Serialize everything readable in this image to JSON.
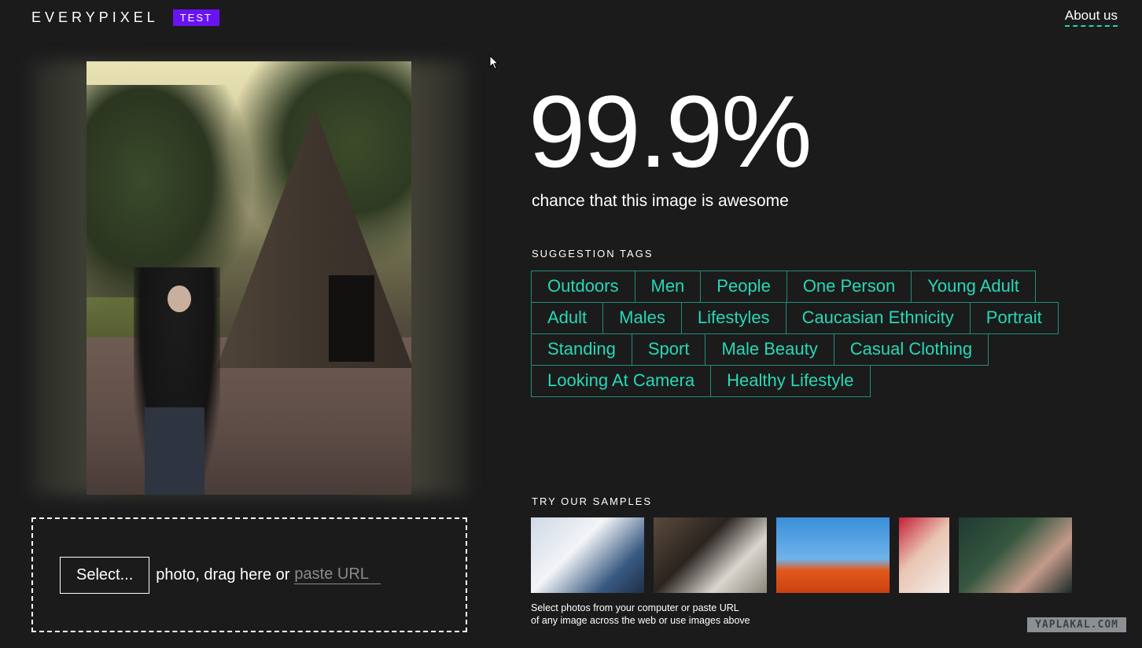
{
  "header": {
    "logo": "EVERYPIXEL",
    "badge": "TEST",
    "about_link": "About us"
  },
  "result": {
    "score": "99.9%",
    "caption": "chance that this image is awesome"
  },
  "tags_section": {
    "label": "SUGGESTION TAGS",
    "rows": [
      [
        "Outdoors",
        "Men",
        "People",
        "One Person",
        "Young Adult"
      ],
      [
        "Adult",
        "Males",
        "Lifestyles",
        "Caucasian Ethnicity",
        "Portrait"
      ],
      [
        "Standing",
        "Sport",
        "Male Beauty",
        "Casual Clothing"
      ],
      [
        "Looking At Camera",
        "Healthy Lifestyle"
      ]
    ]
  },
  "upload": {
    "select_label": "Select...",
    "drop_text": "photo, drag here or",
    "url_placeholder": "paste URL"
  },
  "samples_section": {
    "label": "TRY OUR SAMPLES",
    "hint_line1": "Select photos from your computer or paste URL",
    "hint_line2": "of any image across the web or use images above"
  },
  "watermark": "YAPLAKAL.COM",
  "colors": {
    "background": "#1b1b1c",
    "accent": "#26d9b6",
    "tag_border": "#1e8f7b",
    "badge": "#6a13f2"
  },
  "icons": {
    "cursor": "mouse-pointer-icon"
  }
}
